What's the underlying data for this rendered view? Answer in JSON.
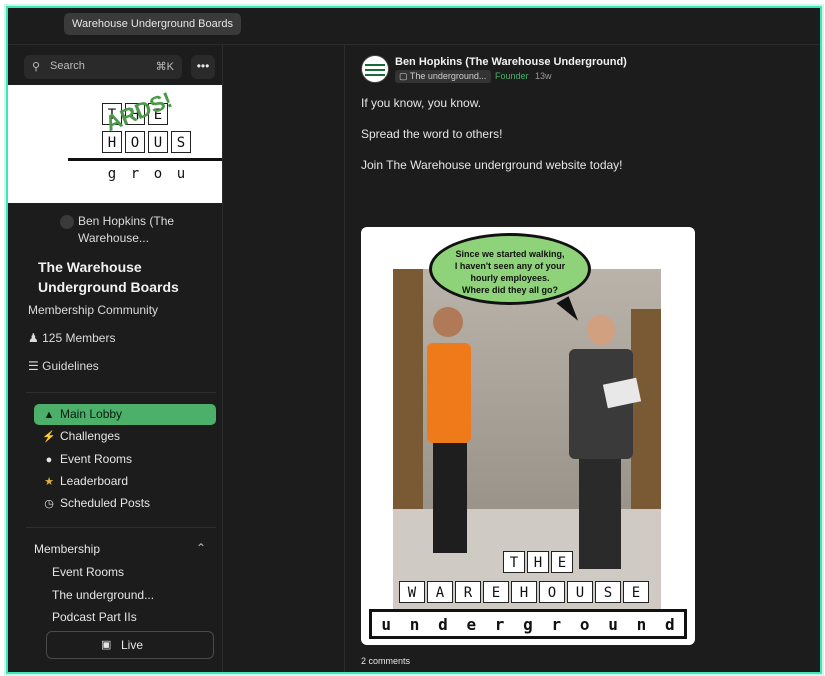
{
  "breadcrumb": {
    "label": "Warehouse Underground Boards"
  },
  "sidebar": {
    "search": {
      "placeholder": "Search",
      "shortcut": "⌘K"
    },
    "more_label": "•••",
    "banner": {
      "row1": [
        "T",
        "H",
        "E"
      ],
      "row2": [
        "H",
        "O",
        "U",
        "S"
      ],
      "row3": [
        "g",
        "r",
        "o",
        "u"
      ],
      "stamp": "ARDS!"
    },
    "owner_name": "Ben Hopkins (The Warehouse...",
    "community_name": "The Warehouse Underground Boards",
    "community_type": "Membership Community",
    "members": "125 Members",
    "guidelines": "Guidelines",
    "nav": [
      {
        "label": "Main Lobby",
        "icon": "campfire-icon"
      },
      {
        "label": "Challenges",
        "icon": "lightning-icon"
      },
      {
        "label": "Event Rooms",
        "icon": "microphone-icon"
      },
      {
        "label": "Leaderboard",
        "icon": "trophy-icon"
      },
      {
        "label": "Scheduled Posts",
        "icon": "clock-icon"
      }
    ],
    "section_title": "Membership",
    "section_items": [
      "Event Rooms",
      "The underground...",
      "Podcast Part IIs"
    ],
    "live_label": "Live"
  },
  "post": {
    "author": "Ben Hopkins (The Warehouse Underground)",
    "tag": "The underground...",
    "badge": "Founder",
    "age": "13w",
    "paragraphs": [
      "If you know, you know.",
      "Spread the word to others!",
      "Join The Warehouse underground website today!"
    ],
    "image": {
      "bubble_lines": [
        "Since we started walking,",
        "I haven't seen any of your",
        "hourly employees.",
        "Where did they all go?"
      ],
      "row_the": [
        "T",
        "H",
        "E"
      ],
      "row_warehouse": [
        "W",
        "A",
        "R",
        "E",
        "H",
        "O",
        "U",
        "S",
        "E"
      ],
      "row_underground": [
        "u",
        "n",
        "d",
        "e",
        "r",
        "g",
        "r",
        "o",
        "u",
        "n",
        "d"
      ]
    },
    "comments": "2 comments"
  },
  "colors": {
    "accent": "#4caf6a",
    "frame": "#3fe6b6",
    "background": "#1c1c1c"
  }
}
